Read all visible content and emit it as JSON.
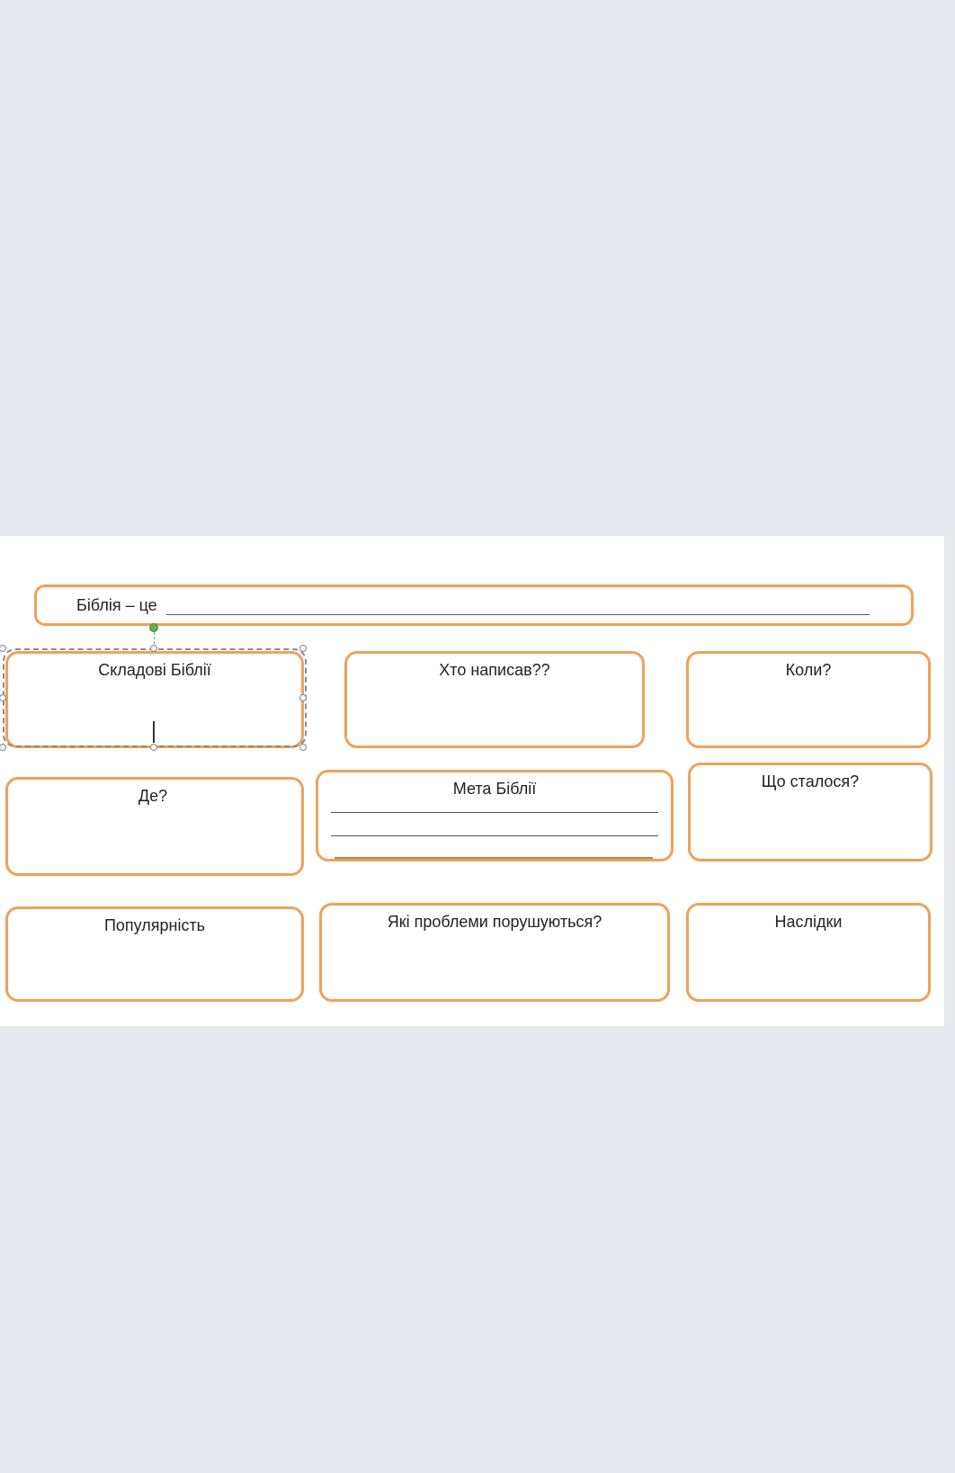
{
  "worksheet": {
    "definition": {
      "label": "Біблія – це"
    },
    "boxes": {
      "components": "Складові Біблії",
      "who_wrote": "Хто написав??",
      "when": "Коли?",
      "where": "Де?",
      "purpose": "Мета Біблії",
      "what_happened": "Що сталося?",
      "popularity": "Популярність",
      "issues": "Які проблеми порушуються?",
      "consequences": "Наслідки"
    }
  },
  "colors": {
    "page_background": "#e8e9ee",
    "sheet_background": "#ffffff",
    "box_border": "#f0a15a",
    "selection_frame": "#8a8a8a",
    "rotation_handle": "#6ab04c"
  }
}
